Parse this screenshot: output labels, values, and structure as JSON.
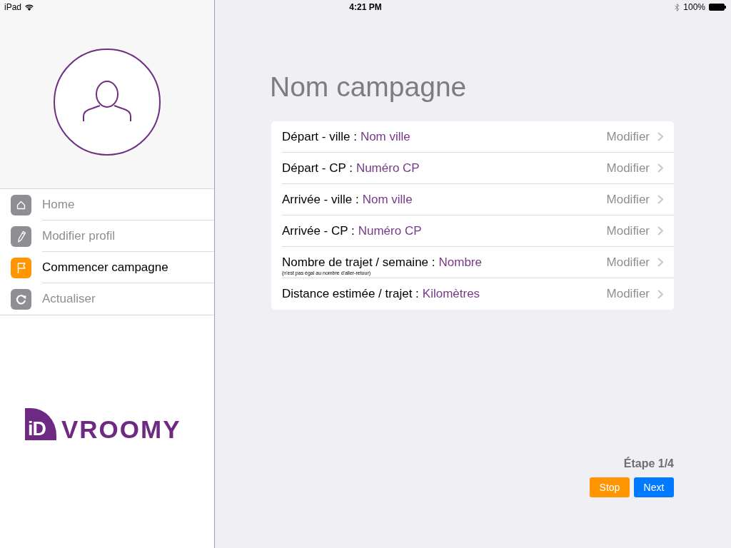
{
  "status_bar": {
    "carrier": "iPad",
    "time": "4:21 PM",
    "battery": "100%"
  },
  "sidebar": {
    "items": [
      {
        "label": "Home",
        "kind": "home",
        "selected": false
      },
      {
        "label": "Modifier profil",
        "kind": "edit",
        "selected": false
      },
      {
        "label": "Commencer campagne",
        "kind": "flag",
        "selected": true
      },
      {
        "label": "Actualiser",
        "kind": "refresh",
        "selected": false
      }
    ]
  },
  "logo": {
    "mark": "iD",
    "name": "VROOMY"
  },
  "main": {
    "title": "Nom campagne",
    "rows": [
      {
        "label": "Départ - ville :",
        "value": "Nom ville",
        "action": "Modifier"
      },
      {
        "label": "Départ - CP :",
        "value": "Numéro CP",
        "action": "Modifier"
      },
      {
        "label": "Arrivée - ville :",
        "value": "Nom ville",
        "action": "Modifier"
      },
      {
        "label": "Arrivée - CP :",
        "value": "Numéro CP",
        "action": "Modifier"
      },
      {
        "label": "Nombre de trajet / semaine :",
        "value": "Nombre",
        "note": "(n'est pas égal au nombre d'aller-retour)",
        "action": "Modifier"
      },
      {
        "label": "Distance estimée / trajet :",
        "value": "Kilomètres",
        "action": "Modifier"
      }
    ],
    "step": "Étape 1/4",
    "buttons": [
      {
        "label": "Stop",
        "kind": "stop"
      },
      {
        "label": "Next",
        "kind": "next"
      }
    ]
  }
}
